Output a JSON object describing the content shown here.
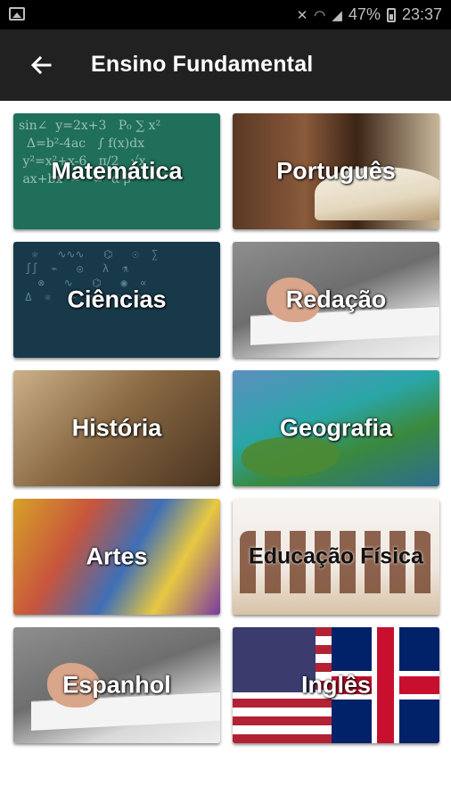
{
  "status_bar": {
    "battery": "47%",
    "time": "23:37",
    "icons": [
      "gallery-icon",
      "mute-icon",
      "wifi-icon",
      "signal-icon",
      "battery-icon"
    ]
  },
  "app_bar": {
    "back_icon": "arrow-back-icon",
    "title": "Ensino Fundamental",
    "background": "#212121"
  },
  "subjects": [
    {
      "label": "Matemática"
    },
    {
      "label": "Português"
    },
    {
      "label": "Ciências"
    },
    {
      "label": "Redação"
    },
    {
      "label": "História"
    },
    {
      "label": "Geografia"
    },
    {
      "label": "Artes"
    },
    {
      "label": "Educação Física"
    },
    {
      "label": "Espanhol"
    },
    {
      "label": "Inglês"
    }
  ]
}
